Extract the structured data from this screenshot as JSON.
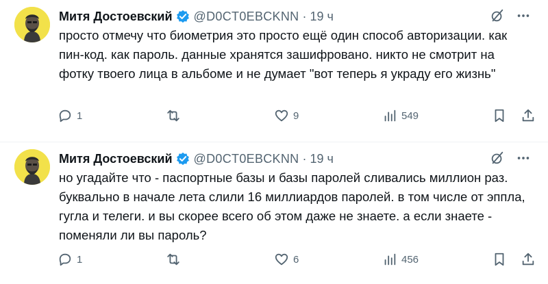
{
  "colors": {
    "verified": "#1d9bf0",
    "avatar_bg": "#f2e14a",
    "muted": "#536471",
    "text": "#0f1419"
  },
  "tweets": [
    {
      "name": "Митя Достоевский",
      "handle": "@D0CT0EBCKNN",
      "dot": "·",
      "time": "19 ч",
      "text": "просто отмечу что биометрия это просто ещё один способ авторизации. как пин-код. как пароль. данные хранятся зашифровано. никто не смотрит на фотку твоего лица в альбоме и не думает \"вот теперь я украду его жизнь\"",
      "replies": "1",
      "retweets": "",
      "likes": "9",
      "views": "549",
      "icons": [
        "grok-icon",
        "more-icon",
        "reply-icon",
        "retweet-icon",
        "like-icon",
        "views-icon",
        "bookmark-icon",
        "share-icon"
      ]
    },
    {
      "name": "Митя Достоевский",
      "handle": "@D0CT0EBCKNN",
      "dot": "·",
      "time": "19 ч",
      "text": "но угадайте что - паспортные базы и базы паролей сливались миллион раз. буквально в начале лета слили 16 миллиардов паролей. в том числе от эппла, гугла и телеги. и вы скорее всего об этом даже не знаете. а если знаете - поменяли ли вы пароль?",
      "replies": "1",
      "retweets": "",
      "likes": "6",
      "views": "456",
      "icons": [
        "grok-icon",
        "more-icon",
        "reply-icon",
        "retweet-icon",
        "like-icon",
        "views-icon",
        "bookmark-icon",
        "share-icon"
      ]
    }
  ]
}
